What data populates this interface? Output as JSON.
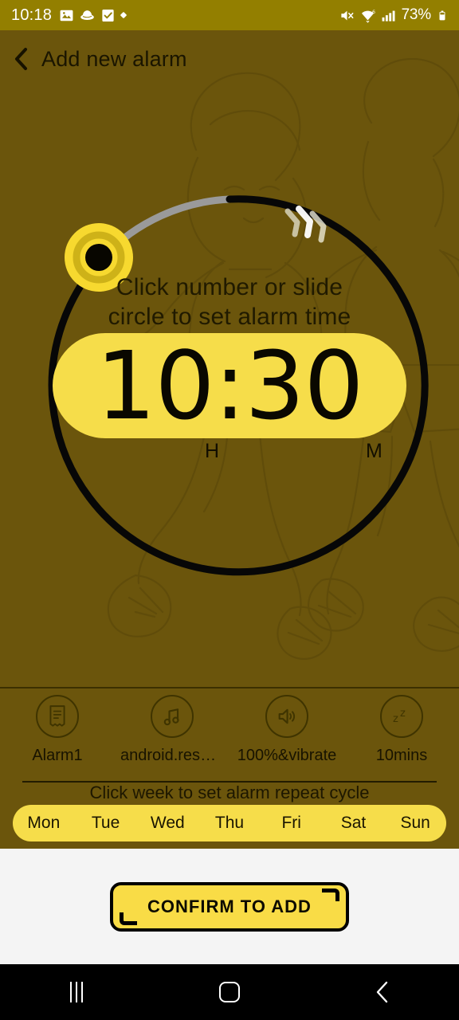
{
  "statusbar": {
    "clock": "10:18",
    "battery": "73%",
    "icons": [
      "photo-icon",
      "hat-icon",
      "checkbox-icon",
      "diamond-dot-icon"
    ],
    "right_icons": [
      "mute-icon",
      "wifi-icon",
      "signal-icon",
      "battery-icon"
    ],
    "background": "#937f00"
  },
  "appbar": {
    "back_icon": "back-chevron-icon",
    "title": "Add new alarm"
  },
  "dial": {
    "hint_line1": "Click number or slide",
    "hint_line2": "circle to set alarm time",
    "time": "10:30",
    "hours": "10",
    "separator": ":",
    "minutes": "30",
    "hour_label": "H",
    "minute_label": "M",
    "track_active_color": "#000000",
    "track_inactive_color": "#9a9a9a",
    "handle_color": "#f7d92f",
    "pill_color": "#f6dd4a",
    "direction_icon": "chevrons-arrow-icon"
  },
  "settings": [
    {
      "icon": "label-note-icon",
      "label": "Alarm1"
    },
    {
      "icon": "music-note-icon",
      "label": "android.reso…"
    },
    {
      "icon": "volume-icon",
      "label": "100%&vibrate"
    },
    {
      "icon": "snooze-zz-icon",
      "label": "10mins"
    }
  ],
  "week": {
    "hint": "Click week to set alarm repeat cycle",
    "days": [
      "Mon",
      "Tue",
      "Wed",
      "Thu",
      "Fri",
      "Sat",
      "Sun"
    ],
    "bar_color": "#f6dd4a"
  },
  "footer": {
    "confirm_label": "CONFIRM TO ADD",
    "button_color": "#f9dc46",
    "panel_color": "#f4f4f4"
  },
  "navbar": {
    "recents": "recents-icon",
    "home": "home-icon",
    "back": "back-icon"
  },
  "theme": {
    "background": "#6b550c",
    "accent": "#f6dd4a",
    "text_dark": "#1a1500"
  }
}
